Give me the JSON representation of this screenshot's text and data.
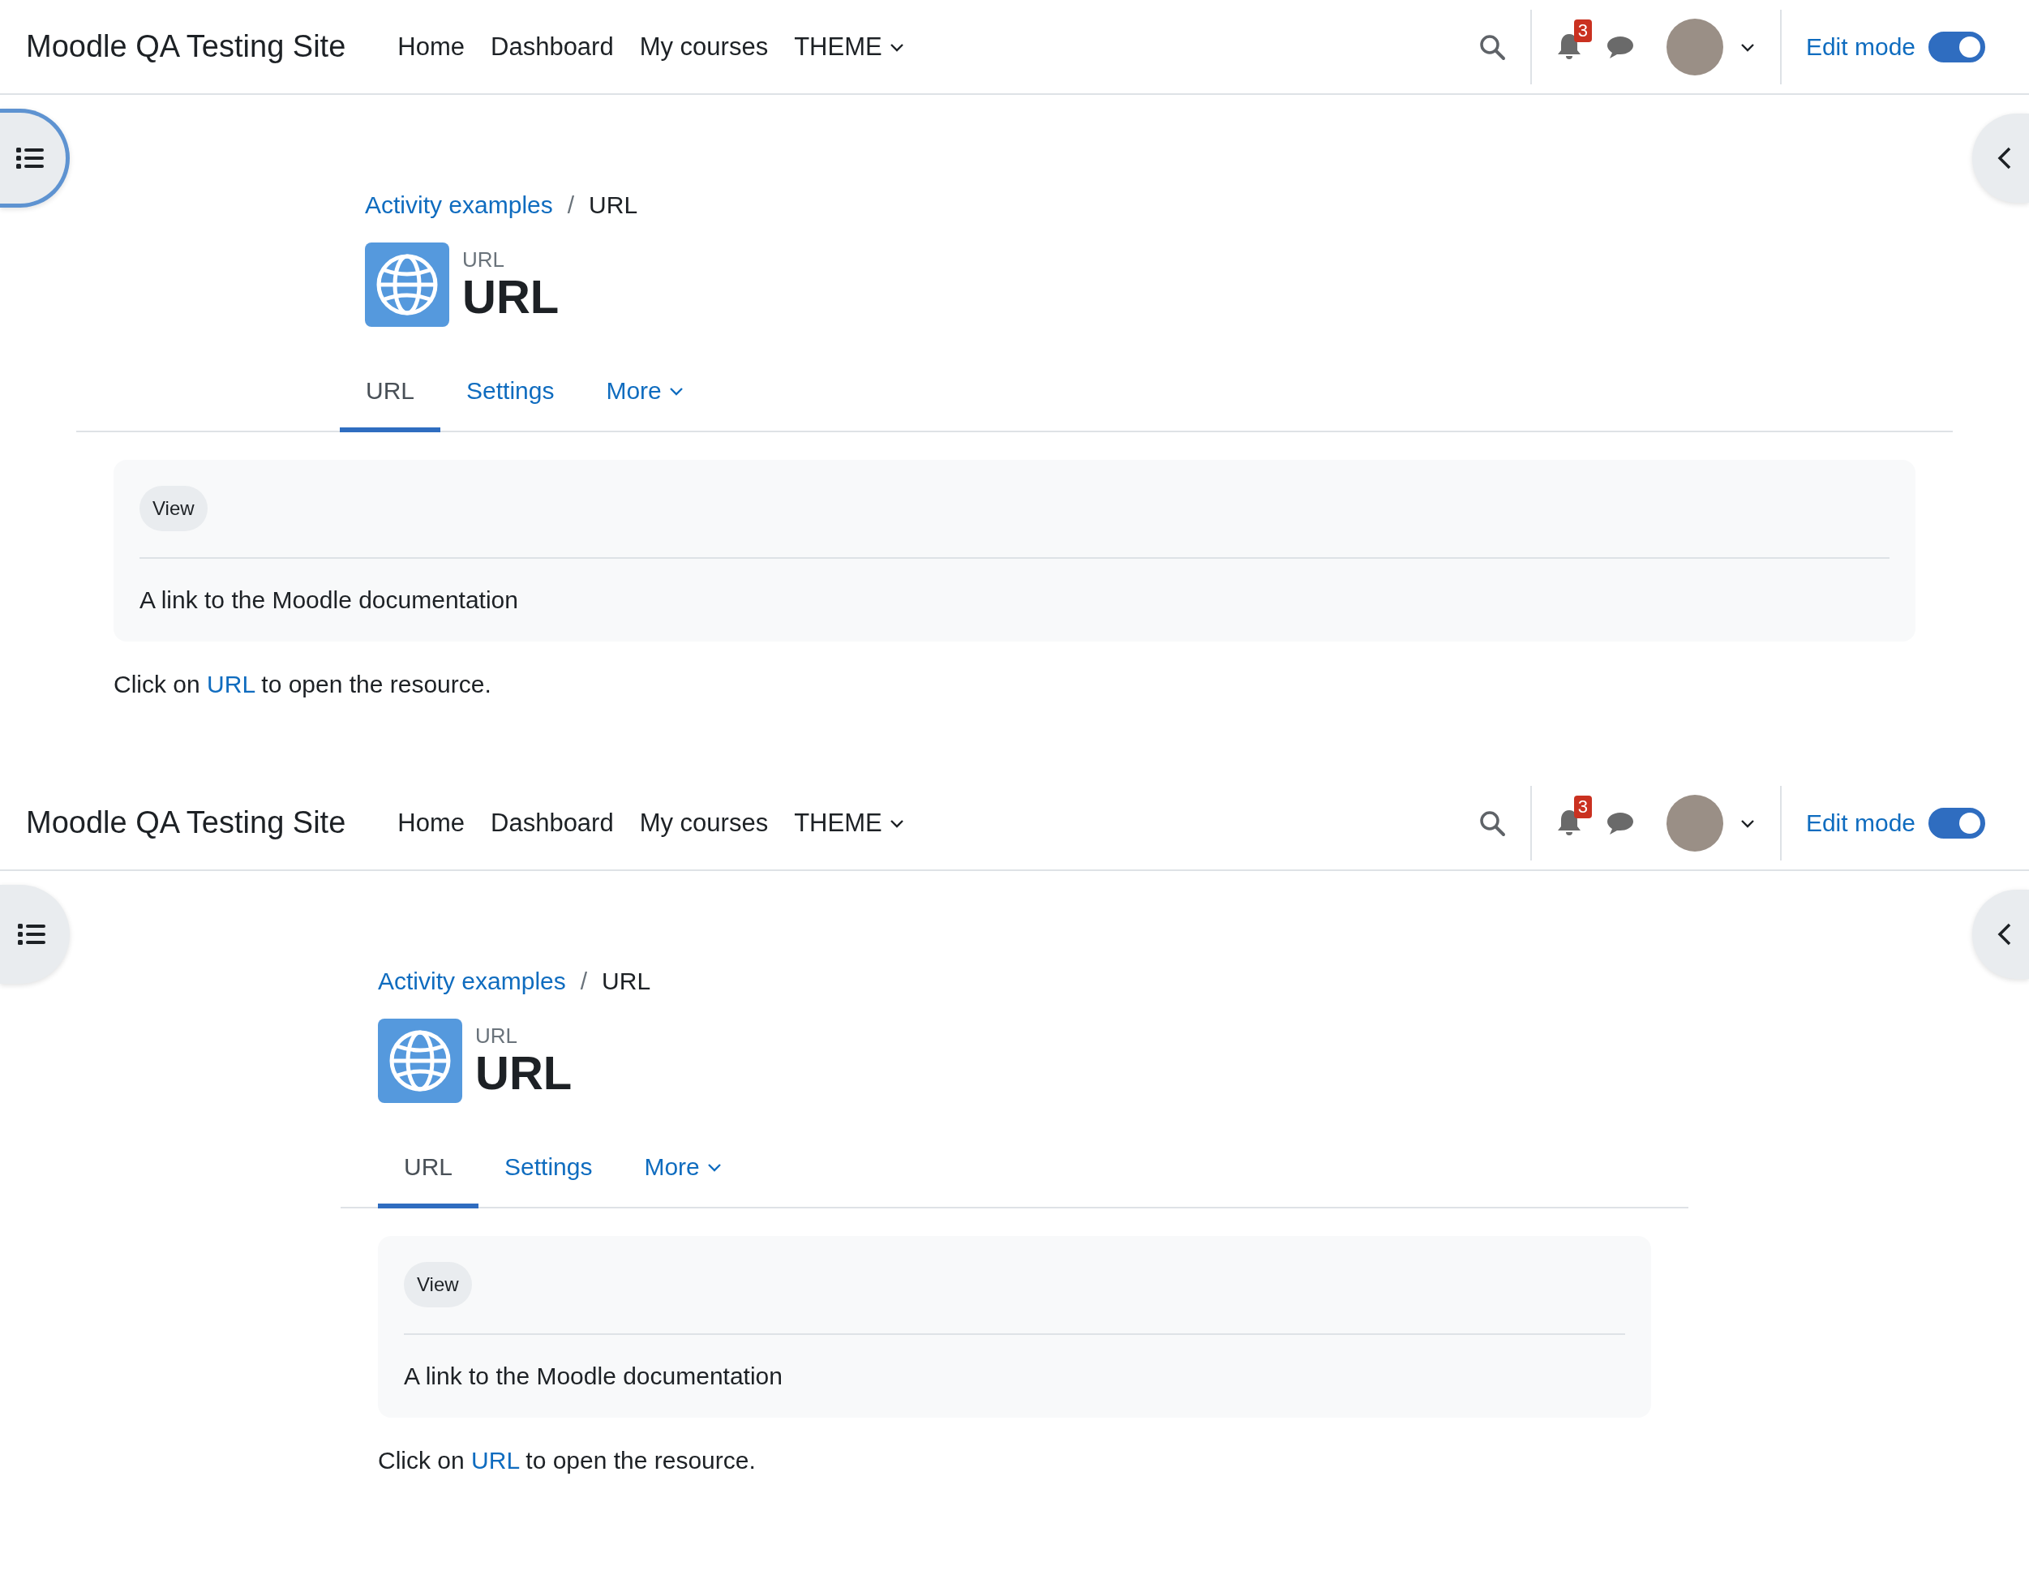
{
  "panels": [
    {
      "kind": "wide",
      "drawer_button": {
        "focused": true
      },
      "site_name": "Moodle QA Testing Site",
      "nav": [
        {
          "label": "Home",
          "dropdown": false
        },
        {
          "label": "Dashboard",
          "dropdown": false
        },
        {
          "label": "My courses",
          "dropdown": false
        },
        {
          "label": "THEME",
          "dropdown": true
        }
      ],
      "notification_count": "3",
      "edit_mode": {
        "label": "Edit mode",
        "on": true
      },
      "breadcrumb": [
        {
          "label": "Activity examples",
          "link": true
        },
        {
          "separator": "/",
          "label": "URL",
          "link": false
        }
      ],
      "activity": {
        "type_label": "URL",
        "title": "URL"
      },
      "tabs": [
        {
          "label": "URL",
          "selected": true,
          "dropdown": false
        },
        {
          "label": "Settings",
          "selected": false,
          "dropdown": false
        },
        {
          "label": "More",
          "selected": false,
          "dropdown": true
        }
      ],
      "card": {
        "badge": "View",
        "description": "A link to the Moodle documentation"
      },
      "instruction": {
        "before": "Click on",
        "link": "URL",
        "after": "to open the resource."
      }
    },
    {
      "kind": "narrow",
      "drawer_button": {
        "focused": false
      },
      "site_name": "Moodle QA Testing Site",
      "nav": [
        {
          "label": "Home",
          "dropdown": false
        },
        {
          "label": "Dashboard",
          "dropdown": false
        },
        {
          "label": "My courses",
          "dropdown": false
        },
        {
          "label": "THEME",
          "dropdown": true
        }
      ],
      "notification_count": "3",
      "edit_mode": {
        "label": "Edit mode",
        "on": true
      },
      "breadcrumb": [
        {
          "label": "Activity examples",
          "link": true
        },
        {
          "separator": "/",
          "label": "URL",
          "link": false
        }
      ],
      "activity": {
        "type_label": "URL",
        "title": "URL"
      },
      "tabs": [
        {
          "label": "URL",
          "selected": true,
          "dropdown": false
        },
        {
          "label": "Settings",
          "selected": false,
          "dropdown": false
        },
        {
          "label": "More",
          "selected": false,
          "dropdown": true
        }
      ],
      "card": {
        "badge": "View",
        "description": "A link to the Moodle documentation"
      },
      "instruction": {
        "before": "Click on",
        "link": "URL",
        "after": "to open the resource."
      }
    }
  ]
}
